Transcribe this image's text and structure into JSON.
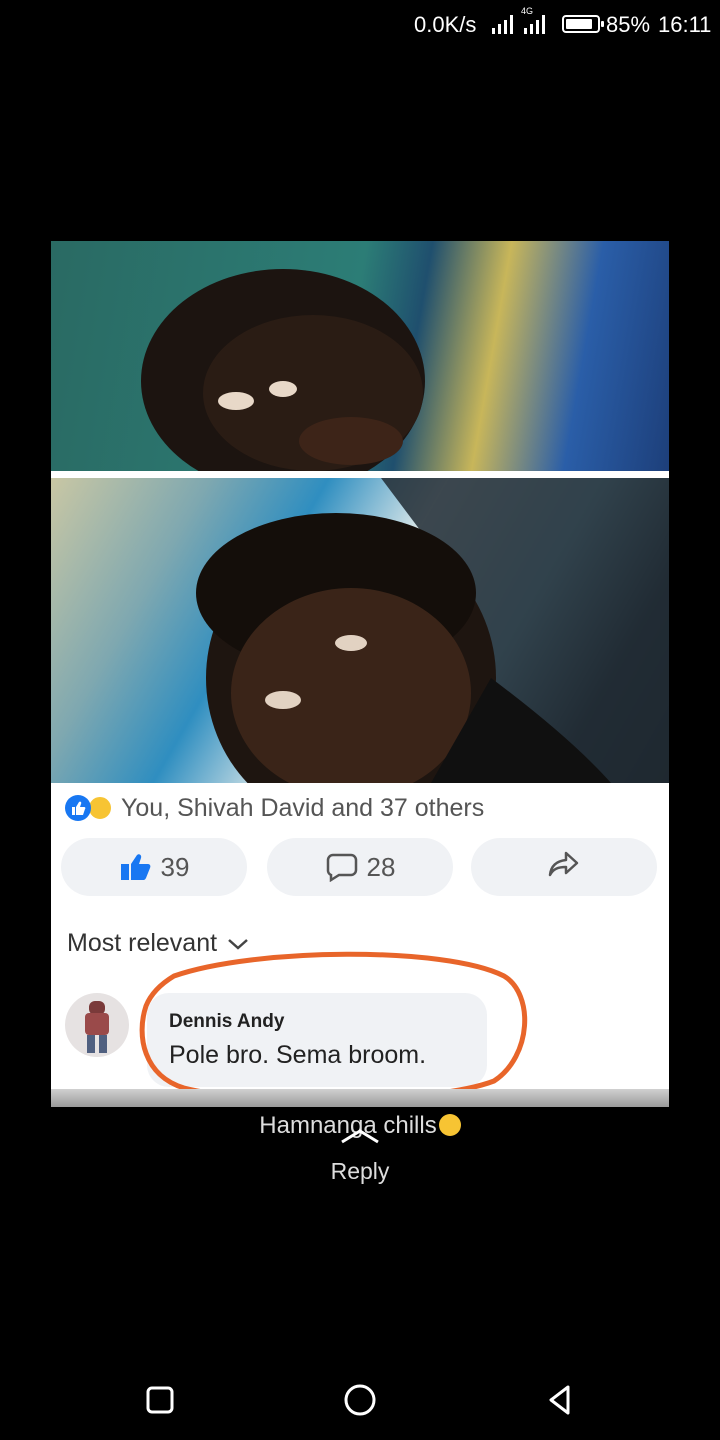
{
  "status_bar": {
    "network_speed": "0.0K/s",
    "network_type": "4G",
    "battery_percent": "85%",
    "battery_level": 0.85,
    "time": "16:11"
  },
  "post": {
    "reactions_text": "You, Shivah David and 37 others",
    "like_count": "39",
    "comment_count": "28",
    "sort_label": "Most relevant",
    "comment": {
      "author": "Dennis Andy",
      "text": "Pole bro. Sema broom."
    }
  },
  "caption": {
    "text": "Hamnanga chills",
    "reply_label": "Reply"
  },
  "colors": {
    "highlight_ring": "#e8652a",
    "like_blue": "#1877f2",
    "haha_yellow": "#f7c433"
  },
  "icons": [
    "like-reaction-icon",
    "haha-reaction-icon",
    "thumbs-up-icon",
    "comment-icon",
    "share-icon",
    "chevron-down-icon",
    "chevron-up-icon",
    "recents-icon",
    "home-icon",
    "back-icon"
  ]
}
